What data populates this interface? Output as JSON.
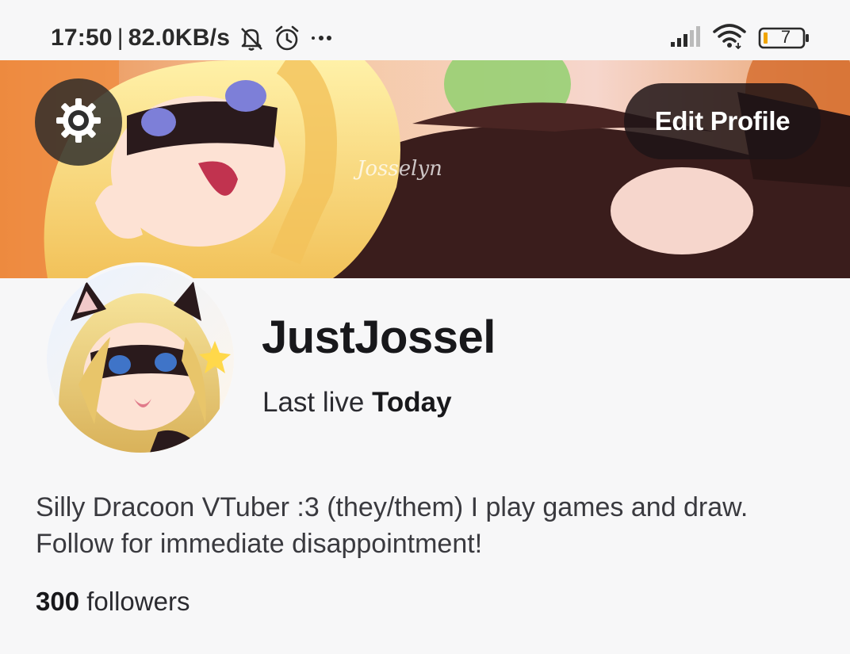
{
  "status_bar": {
    "time": "17:50",
    "separator": "|",
    "network_speed": "82.0KB/s",
    "battery_level": "7",
    "icons": [
      "bell-muted-icon",
      "alarm-icon",
      "more-dots-icon",
      "signal-icon",
      "wifi-icon",
      "battery-icon"
    ]
  },
  "header": {
    "settings_icon": "gear-icon",
    "edit_profile_label": "Edit Profile",
    "banner_watermark": "Josselyn"
  },
  "profile": {
    "username": "JustJossel",
    "last_live_prefix": "Last live",
    "last_live_value": "Today",
    "bio": "Silly Dracoon VTuber :3 (they/them)  I play games and draw. Follow for immediate disappointment!",
    "followers_count": "300",
    "followers_label": "followers"
  },
  "colors": {
    "background": "#f7f7f8",
    "button_dark": "#1e1416",
    "text_primary": "#18181b",
    "battery_low": "#f0a500"
  }
}
